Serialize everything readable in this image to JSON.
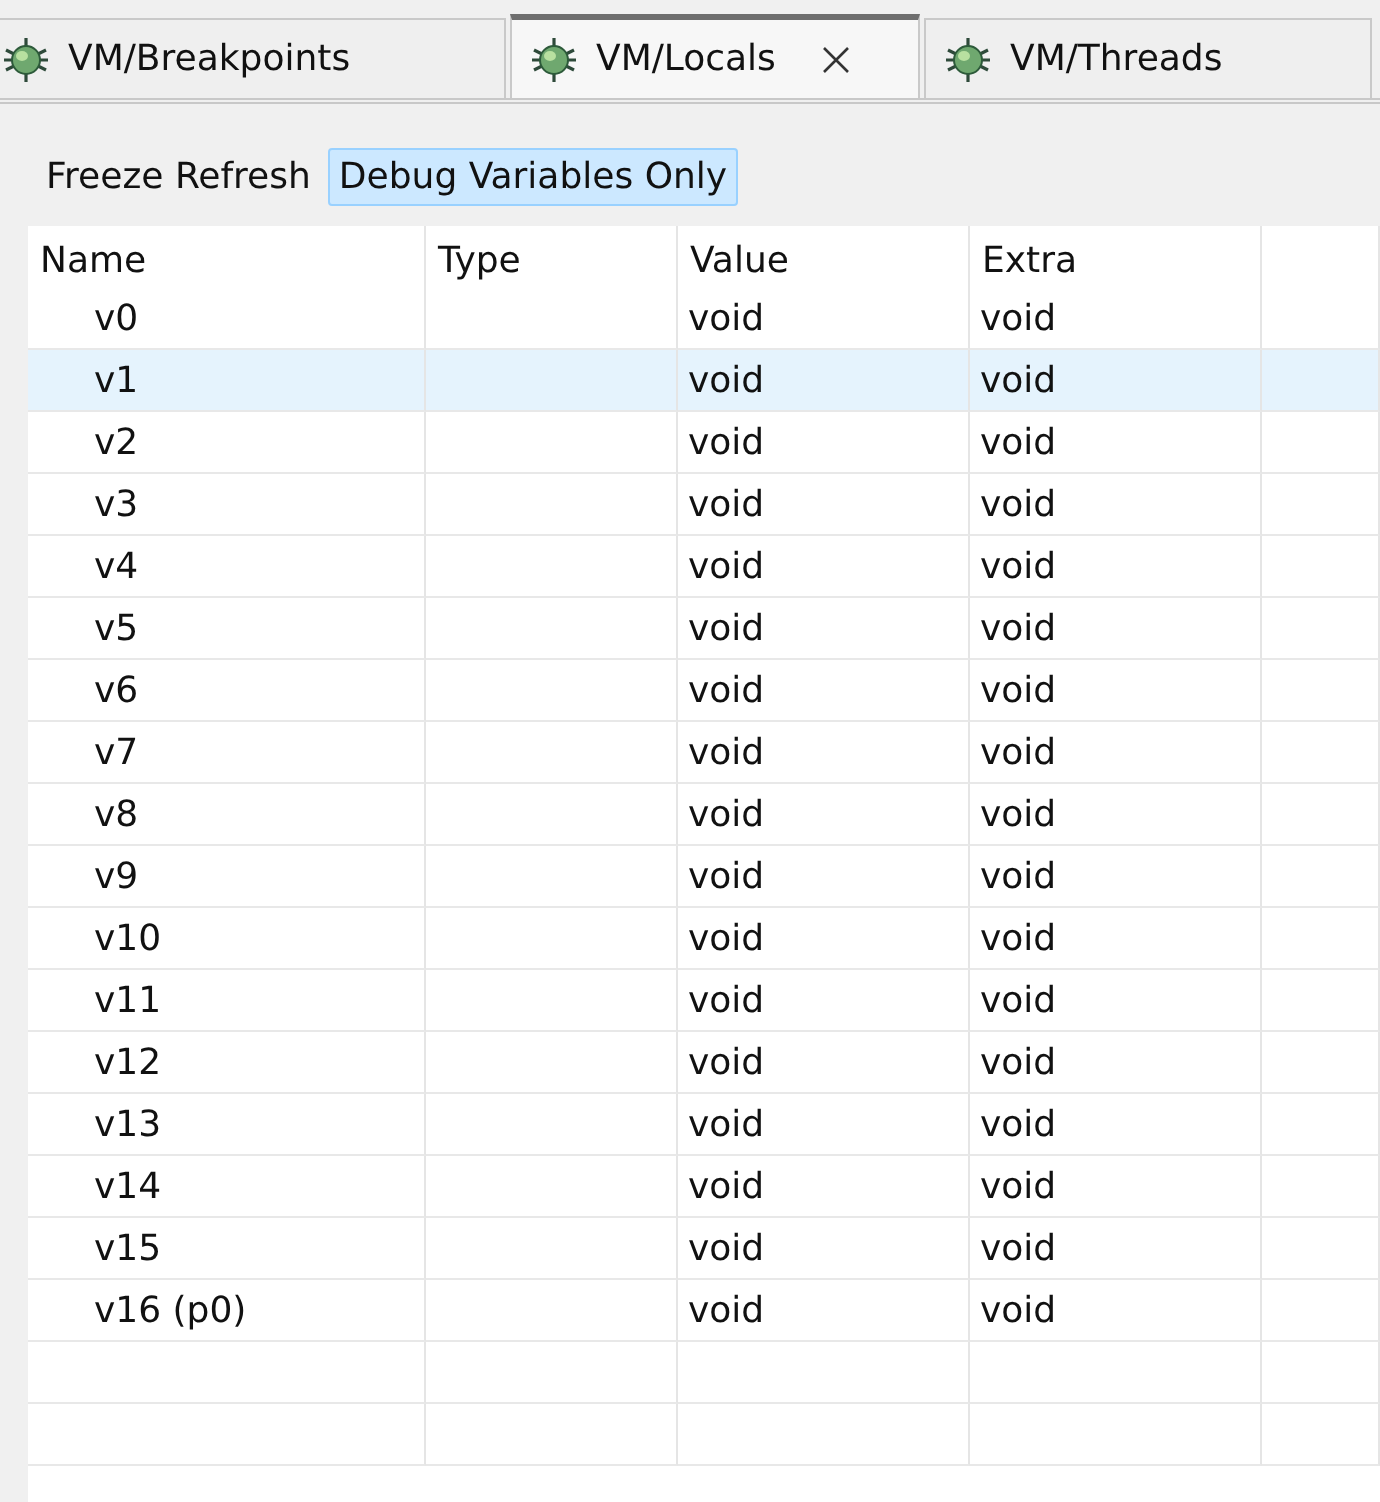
{
  "tabs": [
    {
      "label": "VM/Breakpoints",
      "selected": false,
      "closable": false
    },
    {
      "label": "VM/Locals",
      "selected": true,
      "closable": true
    },
    {
      "label": "VM/Threads",
      "selected": false,
      "closable": false
    }
  ],
  "toolbar": [
    {
      "label": "Freeze Refresh",
      "selected": false
    },
    {
      "label": "Debug Variables Only",
      "selected": true
    }
  ],
  "table": {
    "columns": [
      "Name",
      "Type",
      "Value",
      "Extra"
    ],
    "rows": [
      {
        "name": "v0",
        "type": "",
        "value": "void",
        "extra": "void",
        "selected": false
      },
      {
        "name": "v1",
        "type": "",
        "value": "void",
        "extra": "void",
        "selected": true
      },
      {
        "name": "v2",
        "type": "",
        "value": "void",
        "extra": "void",
        "selected": false
      },
      {
        "name": "v3",
        "type": "",
        "value": "void",
        "extra": "void",
        "selected": false
      },
      {
        "name": "v4",
        "type": "",
        "value": "void",
        "extra": "void",
        "selected": false
      },
      {
        "name": "v5",
        "type": "",
        "value": "void",
        "extra": "void",
        "selected": false
      },
      {
        "name": "v6",
        "type": "",
        "value": "void",
        "extra": "void",
        "selected": false
      },
      {
        "name": "v7",
        "type": "",
        "value": "void",
        "extra": "void",
        "selected": false
      },
      {
        "name": "v8",
        "type": "",
        "value": "void",
        "extra": "void",
        "selected": false
      },
      {
        "name": "v9",
        "type": "",
        "value": "void",
        "extra": "void",
        "selected": false
      },
      {
        "name": "v10",
        "type": "",
        "value": "void",
        "extra": "void",
        "selected": false
      },
      {
        "name": "v11",
        "type": "",
        "value": "void",
        "extra": "void",
        "selected": false
      },
      {
        "name": "v12",
        "type": "",
        "value": "void",
        "extra": "void",
        "selected": false
      },
      {
        "name": "v13",
        "type": "",
        "value": "void",
        "extra": "void",
        "selected": false
      },
      {
        "name": "v14",
        "type": "",
        "value": "void",
        "extra": "void",
        "selected": false
      },
      {
        "name": "v15",
        "type": "",
        "value": "void",
        "extra": "void",
        "selected": false
      },
      {
        "name": "v16 (p0)",
        "type": "",
        "value": "void",
        "extra": "void",
        "selected": false
      }
    ]
  }
}
